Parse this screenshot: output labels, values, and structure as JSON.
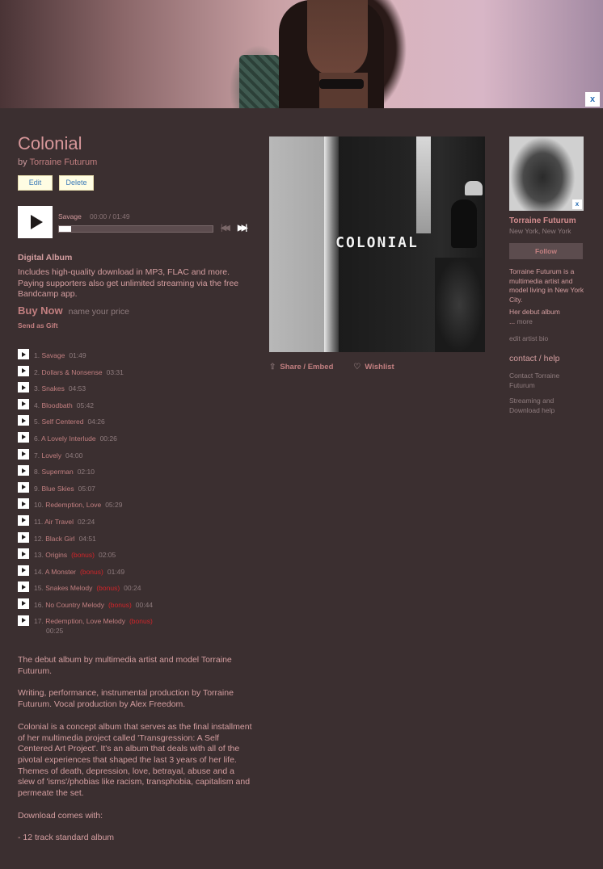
{
  "banner": {
    "close_label": "x"
  },
  "album": {
    "title": "Colonial",
    "by_prefix": "by",
    "artist": "Torraine Futurum",
    "edit_label": "Edit",
    "delete_label": "Delete"
  },
  "player": {
    "track_title": "Savage",
    "time": "00:00 / 01:49",
    "progress_fraction": 0.08,
    "prev_icon": "prev-track-icon",
    "next_icon": "next-track-icon"
  },
  "purchase": {
    "heading": "Digital Album",
    "description": "Includes high-quality download in MP3, FLAC and more. Paying supporters also get unlimited streaming via the free Bandcamp app.",
    "buy_label": "Buy Now",
    "price_label": "name your price",
    "gift_label": "Send as Gift"
  },
  "tracks": [
    {
      "num": "1.",
      "name": "Savage",
      "bonus": "",
      "duration": "01:49"
    },
    {
      "num": "2.",
      "name": "Dollars & Nonsense",
      "bonus": "",
      "duration": "03:31"
    },
    {
      "num": "3.",
      "name": "Snakes",
      "bonus": "",
      "duration": "04:53"
    },
    {
      "num": "4.",
      "name": "Bloodbath",
      "bonus": "",
      "duration": "05:42"
    },
    {
      "num": "5.",
      "name": "Self Centered",
      "bonus": "",
      "duration": "04:26"
    },
    {
      "num": "6.",
      "name": "A Lovely Interlude",
      "bonus": "",
      "duration": "00:26"
    },
    {
      "num": "7.",
      "name": "Lovely",
      "bonus": "",
      "duration": "04:00"
    },
    {
      "num": "8.",
      "name": "Superman",
      "bonus": "",
      "duration": "02:10"
    },
    {
      "num": "9.",
      "name": "Blue Skies",
      "bonus": "",
      "duration": "05:07"
    },
    {
      "num": "10.",
      "name": "Redemption, Love",
      "bonus": "",
      "duration": "05:29"
    },
    {
      "num": "11.",
      "name": "Air Travel",
      "bonus": "",
      "duration": "02:24"
    },
    {
      "num": "12.",
      "name": "Black Girl",
      "bonus": "",
      "duration": "04:51"
    },
    {
      "num": "13.",
      "name": "Origins",
      "bonus": "(bonus)",
      "duration": "02:05"
    },
    {
      "num": "14.",
      "name": "A Monster",
      "bonus": "(bonus)",
      "duration": "01:49"
    },
    {
      "num": "15.",
      "name": "Snakes Melody",
      "bonus": "(bonus)",
      "duration": "00:24"
    },
    {
      "num": "16.",
      "name": "No Country Melody",
      "bonus": "(bonus)",
      "duration": "00:44"
    },
    {
      "num": "17.",
      "name": "Redemption, Love Melody",
      "bonus": "(bonus)",
      "duration": "00:25"
    }
  ],
  "about": [
    "The debut album by multimedia artist and model Torraine Futurum.",
    "Writing, performance, instrumental production by Torraine Futurum. Vocal production by Alex Freedom.",
    "Colonial is a concept album that serves as the final installment of her multimedia project called 'Transgression: A Self Centered Art Project'. It's an album that deals with all of the pivotal experiences that shaped the last 3 years of her life. Themes of death, depression, love, betrayal, abuse and a slew of 'isms'/phobias like racism, transphobia, capitalism and permeate the set.",
    "Download comes with:",
    "- 12 track standard album"
  ],
  "cover": {
    "title_text": "COLONIAL"
  },
  "actions": {
    "share_label": "Share / Embed",
    "wishlist_label": "Wishlist"
  },
  "artist_panel": {
    "name": "Torraine Futurum",
    "location": "New York, New York",
    "follow_label": "Follow",
    "photo_close_label": "x",
    "bio": "Torraine Futurum is a multimedia artist and model living in New York City.",
    "bio_more_text": "Her debut album",
    "bio_more_prefix": "...",
    "more_label": "more",
    "edit_bio_label": "edit artist bio",
    "contact_heading": "contact / help",
    "contact_links": [
      "Contact Torraine Futurum",
      "Streaming and Download help"
    ]
  },
  "colors": {
    "background": "#3b2f30",
    "link": "#c27f80",
    "text": "#d49ea0",
    "muted": "#8f7c7e",
    "bonus": "#d1252a"
  }
}
